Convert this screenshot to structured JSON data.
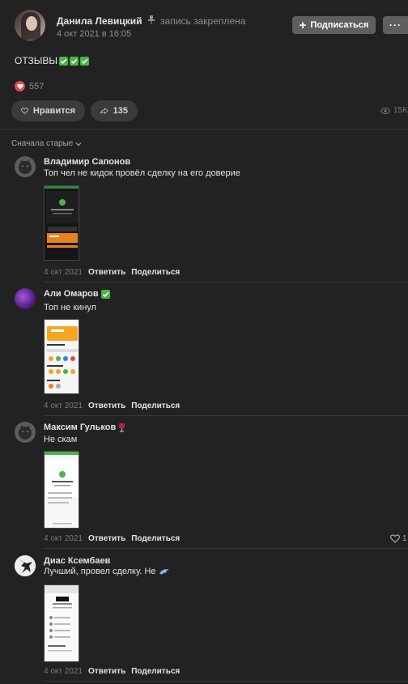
{
  "post": {
    "author": "Данила Левицкий",
    "pinned_label": "запись закреплена",
    "date": "4 окт 2021 в 16:05",
    "subscribe_label": "Подписаться",
    "more_label": "···",
    "text": "ОТЗЫВЫ",
    "reactions_count": "557",
    "like_label": "Нравится",
    "share_count": "135",
    "views": "15K",
    "sort_label": "Сначала старые"
  },
  "comments": [
    {
      "author": "Владимир Сапонов",
      "text": "Топ чел не кидок провёл сделку на его доверие",
      "date": "4 окт 2021",
      "reply_label": "Ответить",
      "share_label": "Поделиться"
    },
    {
      "author": "Али Омаров",
      "text": "Топ не кинул",
      "date": "4 окт 2021",
      "reply_label": "Ответить",
      "share_label": "Поделиться"
    },
    {
      "author": "Максим Гульков",
      "text": "Не скам",
      "date": "4 окт 2021",
      "reply_label": "Ответить",
      "share_label": "Поделиться",
      "like_count": "1"
    },
    {
      "author": "Диас Ксембаев",
      "text": "Лучший, провел сделку. Не",
      "date": "4 окт 2021",
      "reply_label": "Ответить",
      "share_label": "Поделиться"
    }
  ],
  "colors": {
    "background": "#222222",
    "button": "#5d5f61",
    "check_green": "#4bb34b",
    "heart_red": "#e64646"
  }
}
